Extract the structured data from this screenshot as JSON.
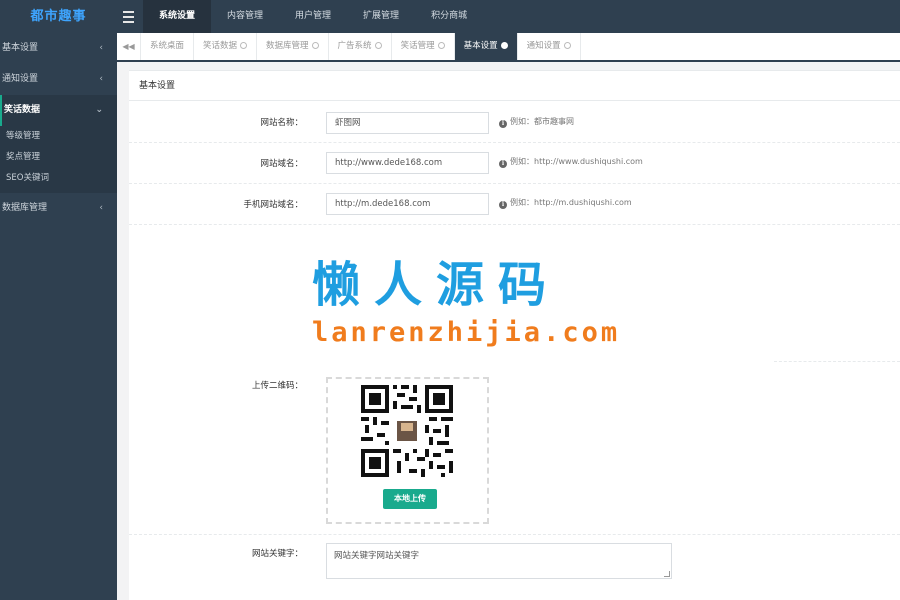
{
  "app": {
    "logo": "都市趣事"
  },
  "topnav": [
    {
      "label": "系统设置",
      "active": true
    },
    {
      "label": "内容管理",
      "active": false
    },
    {
      "label": "用户管理",
      "active": false
    },
    {
      "label": "扩展管理",
      "active": false
    },
    {
      "label": "积分商城",
      "active": false
    }
  ],
  "sidebar": {
    "items": [
      {
        "label": "基本设置",
        "chevron": "‹"
      },
      {
        "label": "通知设置",
        "chevron": "‹"
      },
      {
        "label": "笑话数据",
        "chevron": "⌄"
      },
      {
        "label": "数据库管理",
        "chevron": "‹"
      }
    ],
    "subitems": [
      {
        "label": "等级管理"
      },
      {
        "label": "奖点管理"
      },
      {
        "label": "SEO关键词"
      }
    ]
  },
  "tabs": [
    {
      "label": "系统桌面",
      "active": false,
      "closable": false
    },
    {
      "label": "笑话数据",
      "active": false,
      "closable": true
    },
    {
      "label": "数据库管理",
      "active": false,
      "closable": true
    },
    {
      "label": "广告系统",
      "active": false,
      "closable": true
    },
    {
      "label": "笑话管理",
      "active": false,
      "closable": true
    },
    {
      "label": "基本设置",
      "active": true,
      "closable": true
    },
    {
      "label": "通知设置",
      "active": false,
      "closable": true
    }
  ],
  "panel": {
    "title": "基本设置",
    "fields": {
      "site_name": {
        "label": "网站名称：",
        "value": "虾图网",
        "hint": "例如：都市趣事网"
      },
      "site_domain": {
        "label": "网站域名：",
        "value": "http://www.dede168.com",
        "hint": "例如：http://www.dushiqushi.com"
      },
      "mobile_domain": {
        "label": "手机网站域名：",
        "value": "http://m.dede168.com",
        "hint": "例如：http://m.dushiqushi.com"
      },
      "qrcode": {
        "label": "上传二维码：",
        "button": "本地上传"
      },
      "keywords": {
        "label": "网站关键字：",
        "value": "网站关键字网站关键字"
      }
    }
  },
  "watermark": {
    "title": "懒人源码",
    "url": "lanrenzhijia.com"
  },
  "colors": {
    "sidebar": "#2f4050",
    "accent": "#19aa8d",
    "logo": "#3ea5ff"
  }
}
